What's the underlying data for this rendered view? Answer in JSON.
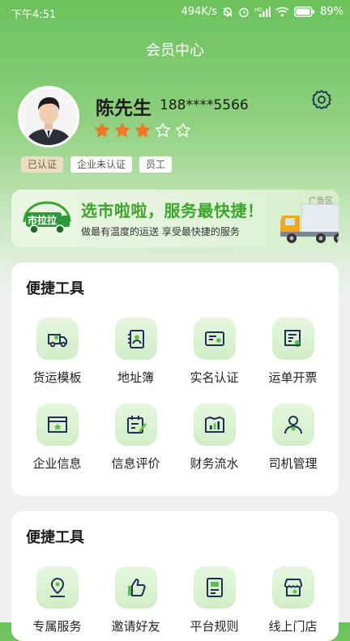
{
  "status_bar": {
    "time": "下午4:51",
    "net_speed": "494K/s",
    "battery": "89%"
  },
  "header": {
    "title": "会员中心"
  },
  "profile": {
    "name": "陈先生",
    "phone": "188****5566",
    "rating": 3,
    "rating_max": 5,
    "tags": [
      "已认证",
      "企业未认证",
      "员工"
    ]
  },
  "ad": {
    "logo_text": "市拉拉",
    "title": "选市啦啦，服务最快捷！",
    "subtitle": "做最有温度的运送 享受最快捷的服务",
    "tag": "广告区"
  },
  "tools_section_1": {
    "title": "便捷工具",
    "items": [
      {
        "label": "货运模板",
        "icon": "truck-location-icon"
      },
      {
        "label": "地址簿",
        "icon": "address-book-icon"
      },
      {
        "label": "实名认证",
        "icon": "id-card-icon"
      },
      {
        "label": "运单开票",
        "icon": "invoice-icon"
      },
      {
        "label": "企业信息",
        "icon": "company-icon"
      },
      {
        "label": "信息评价",
        "icon": "evaluate-icon"
      },
      {
        "label": "财务流水",
        "icon": "finance-icon"
      },
      {
        "label": "司机管理",
        "icon": "driver-icon"
      }
    ]
  },
  "tools_section_2": {
    "title": "便捷工具",
    "items": [
      {
        "label": "专属服务",
        "icon": "service-icon"
      },
      {
        "label": "邀请好友",
        "icon": "thumbs-up-icon"
      },
      {
        "label": "平台规则",
        "icon": "rules-icon"
      },
      {
        "label": "线上门店",
        "icon": "store-icon"
      }
    ]
  },
  "colors": {
    "brand_green": "#5cbf4a",
    "icon_navy": "#1e2f5a",
    "star_orange": "#f07a24"
  }
}
